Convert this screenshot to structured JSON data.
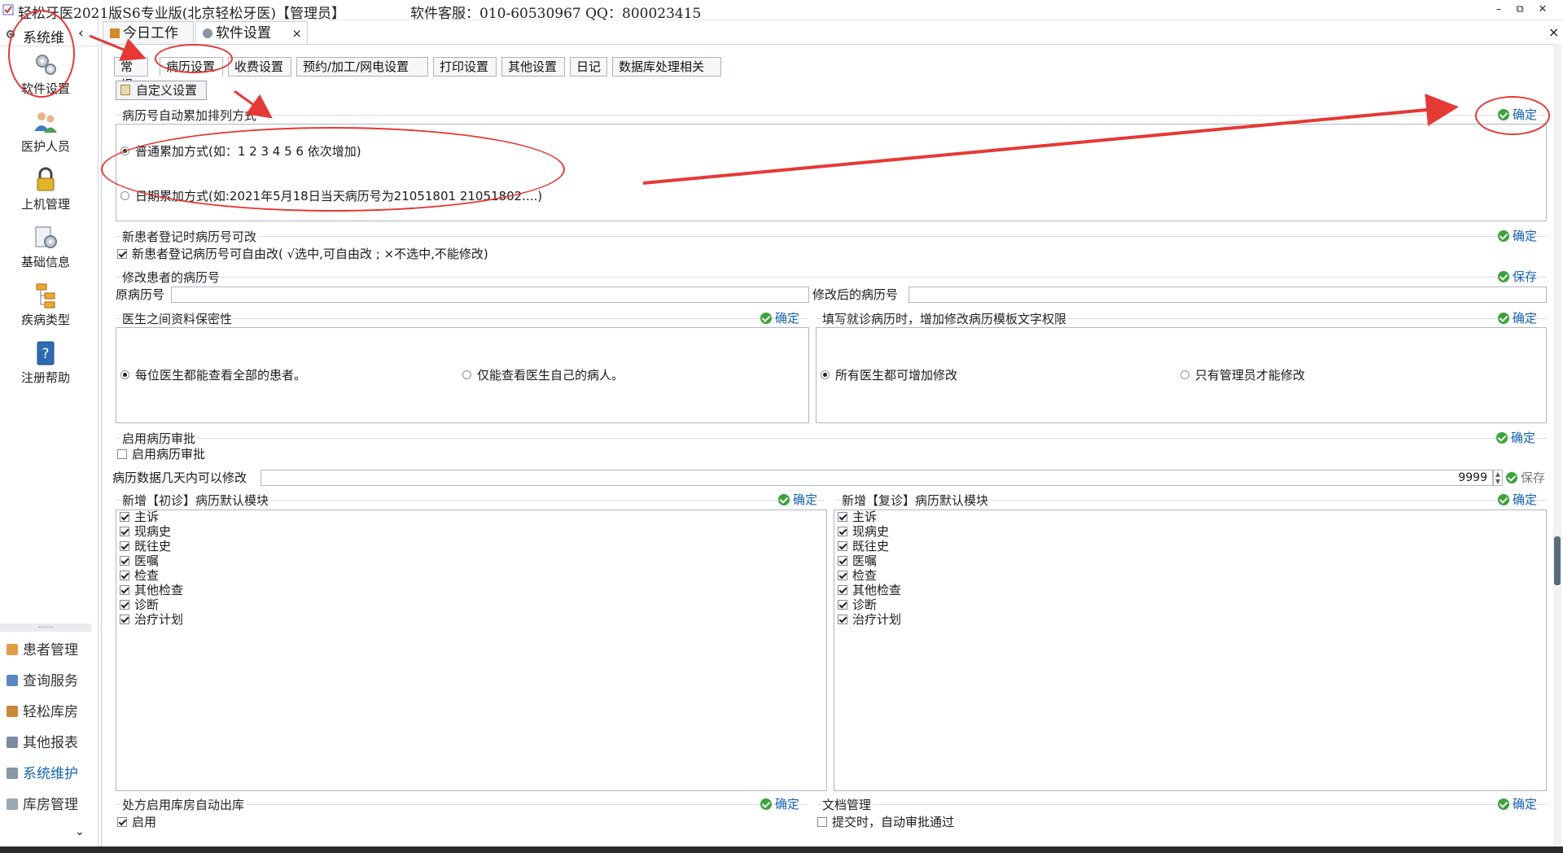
{
  "window": {
    "title": "轻松牙医2021版S6专业版(北京轻松牙医)【管理员】",
    "service": "软件客服：010-60530967 QQ：800023415",
    "min_label": "–",
    "restore_label": "⧉",
    "close_label": "✕"
  },
  "sidebar": {
    "header_label": "系统维",
    "collapse_label": "‹",
    "big_items": [
      {
        "label": "软件设置",
        "icon": "gears-icon"
      },
      {
        "label": "医护人员",
        "icon": "people-icon"
      },
      {
        "label": "上机管理",
        "icon": "lock-icon"
      },
      {
        "label": "基础信息",
        "icon": "settings-doc-icon"
      },
      {
        "label": "疾病类型",
        "icon": "tree-icon"
      },
      {
        "label": "注册帮助",
        "icon": "help-book-icon"
      }
    ],
    "dots": "......",
    "modules": [
      {
        "label": "患者管理",
        "active": false
      },
      {
        "label": "查询服务",
        "active": false
      },
      {
        "label": "轻松库房",
        "active": false
      },
      {
        "label": "其他报表",
        "active": false
      },
      {
        "label": "系统维护",
        "active": true
      },
      {
        "label": "库房管理",
        "active": false
      }
    ],
    "more": "⌄"
  },
  "doc_tabs": [
    {
      "label": "今日工作"
    },
    {
      "label": "软件设置",
      "close": "×"
    }
  ],
  "content_close": "×",
  "sub_tabs": [
    "常规",
    "病历设置",
    "收费设置",
    "预约/加工/网电设置",
    "打印设置",
    "其他设置",
    "日记",
    "数据库处理相关"
  ],
  "custom_btn": "自定义设置",
  "sections": {
    "numbering": {
      "title": "病历号自动累加排列方式",
      "ok": "确定",
      "opt1": "普通累加方式(如：1  2  3  4  5  6 依次增加)",
      "opt2": "日期累加方式(如:2021年5月18日当天病历号为21051801 21051802....)"
    },
    "editable": {
      "title": "新患者登记时病历号可改",
      "ok": "确定",
      "check": "新患者登记病历号可自由改( √选中,可自由改 ;  ×不选中,不能修改)"
    },
    "modify": {
      "title": "修改患者的病历号",
      "save": "保存",
      "orig_label": "原病历号",
      "new_label": "修改后的病历号"
    },
    "privacy": {
      "title": "医生之间资料保密性",
      "ok": "确定",
      "opt1": "每位医生都能查看全部的患者。",
      "opt2": "仅能查看医生自己的病人。"
    },
    "template": {
      "title": "填写就诊病历时，增加修改病历模板文字权限",
      "ok": "确定",
      "opt1": "所有医生都可增加修改",
      "opt2": "只有管理员才能修改"
    },
    "approve": {
      "title": "启用病历审批",
      "ok": "确定",
      "check": "启用病历审批"
    },
    "days": {
      "label": "病历数据几天内可以修改",
      "value": "9999",
      "save": "保存"
    },
    "first_visit": {
      "title": "新增【初诊】病历默认模块",
      "ok": "确定",
      "items": [
        "主诉",
        "现病史",
        "既往史",
        "医嘱",
        "检查",
        "其他检查",
        "诊断",
        "治疗计划"
      ]
    },
    "return_visit": {
      "title": "新增【复诊】病历默认模块",
      "ok": "确定",
      "items": [
        "主诉",
        "现病史",
        "既往史",
        "医嘱",
        "检查",
        "其他检查",
        "诊断",
        "治疗计划"
      ]
    },
    "prescription": {
      "title": "处方启用库房自动出库",
      "ok": "确定",
      "check": "启用"
    },
    "docs": {
      "title": "文档管理",
      "ok": "确定",
      "check": "提交时，自动审批通过"
    }
  },
  "colors": {
    "annotation": "#e53935",
    "link": "#1664b5",
    "ok_icon": "#3aa43a"
  }
}
